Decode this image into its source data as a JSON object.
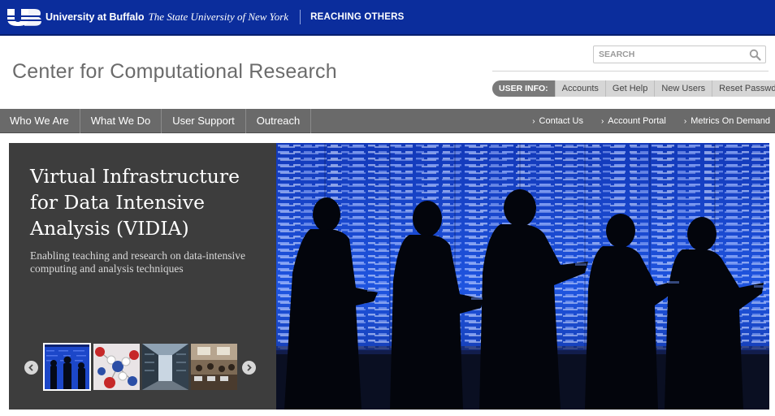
{
  "topbar": {
    "logo_text": "UB",
    "university": "University at Buffalo",
    "tagline": "The State University of New York",
    "slogan": "REACHING OTHERS",
    "bg_color": "#0b2d9c"
  },
  "header": {
    "site_title": "Center for Computational Research",
    "search": {
      "placeholder": "SEARCH",
      "value": "",
      "icon": "magnifier-icon"
    },
    "user_info": {
      "label": "USER INFO:",
      "links": [
        "Accounts",
        "Get Help",
        "New Users",
        "Reset Passwd"
      ]
    }
  },
  "nav": {
    "items": [
      "Who We Are",
      "What We Do",
      "User Support",
      "Outreach"
    ],
    "right_links": [
      "Contact Us",
      "Account Portal",
      "Metrics On Demand"
    ],
    "chevron": "›",
    "bg_color": "#6a6a6a"
  },
  "feature": {
    "title": "Virtual Infrastructure for Data Intensive Analysis (VIDIA)",
    "subtitle": "Enabling teaching and research on data-intensive computing and analysis techniques",
    "prev_icon": "chevron-left-icon",
    "next_icon": "chevron-right-icon",
    "thumbnails": [
      {
        "subject": "silhouettes against data wall",
        "active": true
      },
      {
        "subject": "molecular model",
        "active": false
      },
      {
        "subject": "server room aisle",
        "active": false
      },
      {
        "subject": "classroom with computers",
        "active": false
      }
    ],
    "hero_subject": "silhouetted people holding tablets in front of a blue data wall",
    "bg_color": "#3d3d3d",
    "hero_color": "#1f4fd6"
  }
}
